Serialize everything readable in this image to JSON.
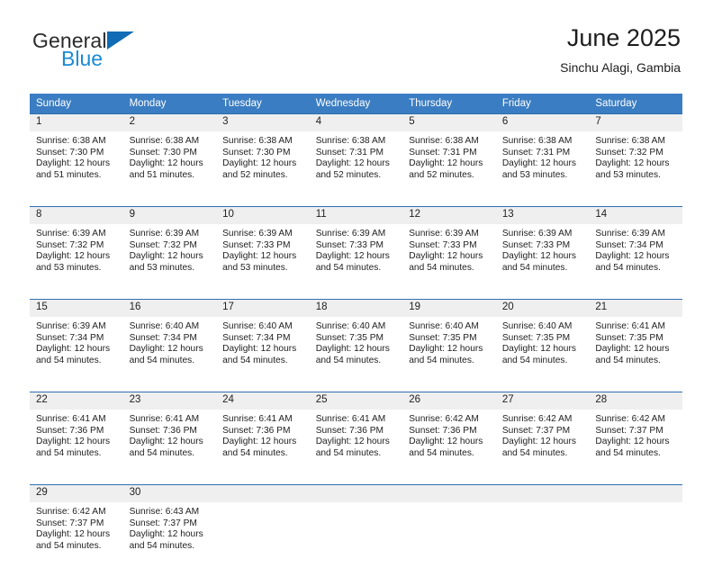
{
  "brand": {
    "word1": "General",
    "word2": "Blue",
    "flag_icon": "triangle-flag-icon",
    "blue_hex": "#1b8ad4",
    "flag_hex": "#0f6cb5"
  },
  "header": {
    "title": "June 2025",
    "location": "Sinchu Alagi, Gambia"
  },
  "calendar": {
    "header_bg": "#3b7dc2",
    "daynum_bg": "#efefef",
    "rule_hex": "#2f6fb0",
    "weekday_headers": [
      "Sunday",
      "Monday",
      "Tuesday",
      "Wednesday",
      "Thursday",
      "Friday",
      "Saturday"
    ],
    "weeks": [
      [
        {
          "day": "1",
          "sunrise": "Sunrise: 6:38 AM",
          "sunset": "Sunset: 7:30 PM",
          "daylight_line1": "Daylight: 12 hours",
          "daylight_line2": "and 51 minutes."
        },
        {
          "day": "2",
          "sunrise": "Sunrise: 6:38 AM",
          "sunset": "Sunset: 7:30 PM",
          "daylight_line1": "Daylight: 12 hours",
          "daylight_line2": "and 51 minutes."
        },
        {
          "day": "3",
          "sunrise": "Sunrise: 6:38 AM",
          "sunset": "Sunset: 7:30 PM",
          "daylight_line1": "Daylight: 12 hours",
          "daylight_line2": "and 52 minutes."
        },
        {
          "day": "4",
          "sunrise": "Sunrise: 6:38 AM",
          "sunset": "Sunset: 7:31 PM",
          "daylight_line1": "Daylight: 12 hours",
          "daylight_line2": "and 52 minutes."
        },
        {
          "day": "5",
          "sunrise": "Sunrise: 6:38 AM",
          "sunset": "Sunset: 7:31 PM",
          "daylight_line1": "Daylight: 12 hours",
          "daylight_line2": "and 52 minutes."
        },
        {
          "day": "6",
          "sunrise": "Sunrise: 6:38 AM",
          "sunset": "Sunset: 7:31 PM",
          "daylight_line1": "Daylight: 12 hours",
          "daylight_line2": "and 53 minutes."
        },
        {
          "day": "7",
          "sunrise": "Sunrise: 6:38 AM",
          "sunset": "Sunset: 7:32 PM",
          "daylight_line1": "Daylight: 12 hours",
          "daylight_line2": "and 53 minutes."
        }
      ],
      [
        {
          "day": "8",
          "sunrise": "Sunrise: 6:39 AM",
          "sunset": "Sunset: 7:32 PM",
          "daylight_line1": "Daylight: 12 hours",
          "daylight_line2": "and 53 minutes."
        },
        {
          "day": "9",
          "sunrise": "Sunrise: 6:39 AM",
          "sunset": "Sunset: 7:32 PM",
          "daylight_line1": "Daylight: 12 hours",
          "daylight_line2": "and 53 minutes."
        },
        {
          "day": "10",
          "sunrise": "Sunrise: 6:39 AM",
          "sunset": "Sunset: 7:33 PM",
          "daylight_line1": "Daylight: 12 hours",
          "daylight_line2": "and 53 minutes."
        },
        {
          "day": "11",
          "sunrise": "Sunrise: 6:39 AM",
          "sunset": "Sunset: 7:33 PM",
          "daylight_line1": "Daylight: 12 hours",
          "daylight_line2": "and 54 minutes."
        },
        {
          "day": "12",
          "sunrise": "Sunrise: 6:39 AM",
          "sunset": "Sunset: 7:33 PM",
          "daylight_line1": "Daylight: 12 hours",
          "daylight_line2": "and 54 minutes."
        },
        {
          "day": "13",
          "sunrise": "Sunrise: 6:39 AM",
          "sunset": "Sunset: 7:33 PM",
          "daylight_line1": "Daylight: 12 hours",
          "daylight_line2": "and 54 minutes."
        },
        {
          "day": "14",
          "sunrise": "Sunrise: 6:39 AM",
          "sunset": "Sunset: 7:34 PM",
          "daylight_line1": "Daylight: 12 hours",
          "daylight_line2": "and 54 minutes."
        }
      ],
      [
        {
          "day": "15",
          "sunrise": "Sunrise: 6:39 AM",
          "sunset": "Sunset: 7:34 PM",
          "daylight_line1": "Daylight: 12 hours",
          "daylight_line2": "and 54 minutes."
        },
        {
          "day": "16",
          "sunrise": "Sunrise: 6:40 AM",
          "sunset": "Sunset: 7:34 PM",
          "daylight_line1": "Daylight: 12 hours",
          "daylight_line2": "and 54 minutes."
        },
        {
          "day": "17",
          "sunrise": "Sunrise: 6:40 AM",
          "sunset": "Sunset: 7:34 PM",
          "daylight_line1": "Daylight: 12 hours",
          "daylight_line2": "and 54 minutes."
        },
        {
          "day": "18",
          "sunrise": "Sunrise: 6:40 AM",
          "sunset": "Sunset: 7:35 PM",
          "daylight_line1": "Daylight: 12 hours",
          "daylight_line2": "and 54 minutes."
        },
        {
          "day": "19",
          "sunrise": "Sunrise: 6:40 AM",
          "sunset": "Sunset: 7:35 PM",
          "daylight_line1": "Daylight: 12 hours",
          "daylight_line2": "and 54 minutes."
        },
        {
          "day": "20",
          "sunrise": "Sunrise: 6:40 AM",
          "sunset": "Sunset: 7:35 PM",
          "daylight_line1": "Daylight: 12 hours",
          "daylight_line2": "and 54 minutes."
        },
        {
          "day": "21",
          "sunrise": "Sunrise: 6:41 AM",
          "sunset": "Sunset: 7:35 PM",
          "daylight_line1": "Daylight: 12 hours",
          "daylight_line2": "and 54 minutes."
        }
      ],
      [
        {
          "day": "22",
          "sunrise": "Sunrise: 6:41 AM",
          "sunset": "Sunset: 7:36 PM",
          "daylight_line1": "Daylight: 12 hours",
          "daylight_line2": "and 54 minutes."
        },
        {
          "day": "23",
          "sunrise": "Sunrise: 6:41 AM",
          "sunset": "Sunset: 7:36 PM",
          "daylight_line1": "Daylight: 12 hours",
          "daylight_line2": "and 54 minutes."
        },
        {
          "day": "24",
          "sunrise": "Sunrise: 6:41 AM",
          "sunset": "Sunset: 7:36 PM",
          "daylight_line1": "Daylight: 12 hours",
          "daylight_line2": "and 54 minutes."
        },
        {
          "day": "25",
          "sunrise": "Sunrise: 6:41 AM",
          "sunset": "Sunset: 7:36 PM",
          "daylight_line1": "Daylight: 12 hours",
          "daylight_line2": "and 54 minutes."
        },
        {
          "day": "26",
          "sunrise": "Sunrise: 6:42 AM",
          "sunset": "Sunset: 7:36 PM",
          "daylight_line1": "Daylight: 12 hours",
          "daylight_line2": "and 54 minutes."
        },
        {
          "day": "27",
          "sunrise": "Sunrise: 6:42 AM",
          "sunset": "Sunset: 7:37 PM",
          "daylight_line1": "Daylight: 12 hours",
          "daylight_line2": "and 54 minutes."
        },
        {
          "day": "28",
          "sunrise": "Sunrise: 6:42 AM",
          "sunset": "Sunset: 7:37 PM",
          "daylight_line1": "Daylight: 12 hours",
          "daylight_line2": "and 54 minutes."
        }
      ],
      [
        {
          "day": "29",
          "sunrise": "Sunrise: 6:42 AM",
          "sunset": "Sunset: 7:37 PM",
          "daylight_line1": "Daylight: 12 hours",
          "daylight_line2": "and 54 minutes."
        },
        {
          "day": "30",
          "sunrise": "Sunrise: 6:43 AM",
          "sunset": "Sunset: 7:37 PM",
          "daylight_line1": "Daylight: 12 hours",
          "daylight_line2": "and 54 minutes."
        },
        {
          "day": "",
          "sunrise": "",
          "sunset": "",
          "daylight_line1": "",
          "daylight_line2": ""
        },
        {
          "day": "",
          "sunrise": "",
          "sunset": "",
          "daylight_line1": "",
          "daylight_line2": ""
        },
        {
          "day": "",
          "sunrise": "",
          "sunset": "",
          "daylight_line1": "",
          "daylight_line2": ""
        },
        {
          "day": "",
          "sunrise": "",
          "sunset": "",
          "daylight_line1": "",
          "daylight_line2": ""
        },
        {
          "day": "",
          "sunrise": "",
          "sunset": "",
          "daylight_line1": "",
          "daylight_line2": ""
        }
      ]
    ]
  }
}
